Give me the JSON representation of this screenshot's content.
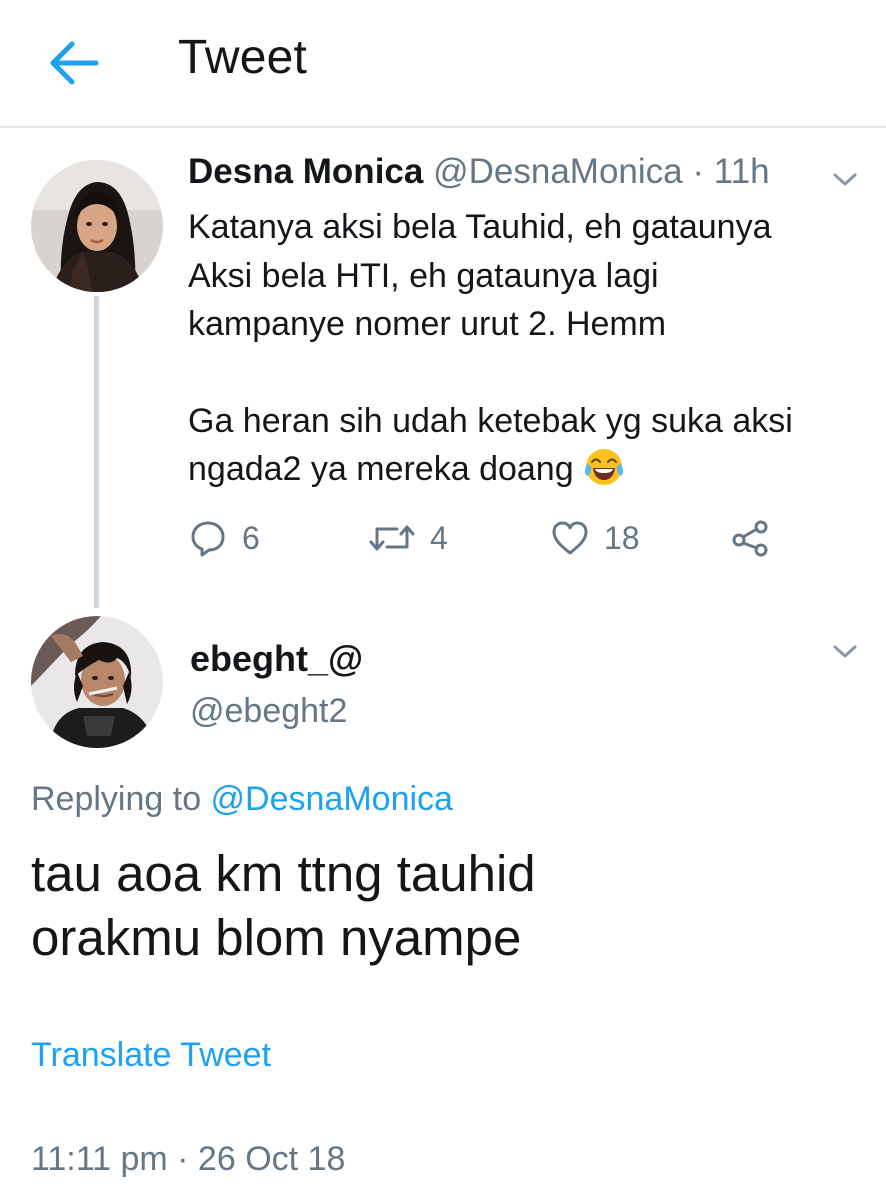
{
  "header": {
    "title": "Tweet",
    "back_icon": "arrow-left-icon",
    "accent": "#1da1f2"
  },
  "original_tweet": {
    "display_name": "Desna Monica",
    "handle": "@DesnaMonica",
    "separator": " · ",
    "time_ago": "11h",
    "text_lines": [
      "Katanya aksi bela Tauhid, eh gataunya",
      "Aksi bela HTI, eh gataunya lagi",
      "kampanye nomer urut 2. Hemm",
      "Ga heran sih udah ketebak yg suka aksi",
      "ngada2 ya mereka doang"
    ],
    "emoji": "face-with-tears-of-joy",
    "actions": {
      "replies": "6",
      "retweets": "4",
      "likes": "18",
      "reply_icon": "reply-icon",
      "retweet_icon": "retweet-icon",
      "like_icon": "heart-icon",
      "share_icon": "share-icon"
    }
  },
  "reply_tweet": {
    "display_name": "ebeght_@",
    "handle": "@ebeght2",
    "replying_prefix": "Replying to ",
    "replying_to": "@DesnaMonica",
    "text_lines": [
      "tau aoa km ttng tauhid",
      "orakmu blom nyampe"
    ],
    "translate_label": "Translate Tweet",
    "timestamp": "11:11 pm · 26 Oct 18"
  },
  "colors": {
    "text": "#14171a",
    "muted": "#657786",
    "link": "#1da1f2",
    "divider": "#e1e8ed",
    "thread_line": "#ccd6dd"
  }
}
